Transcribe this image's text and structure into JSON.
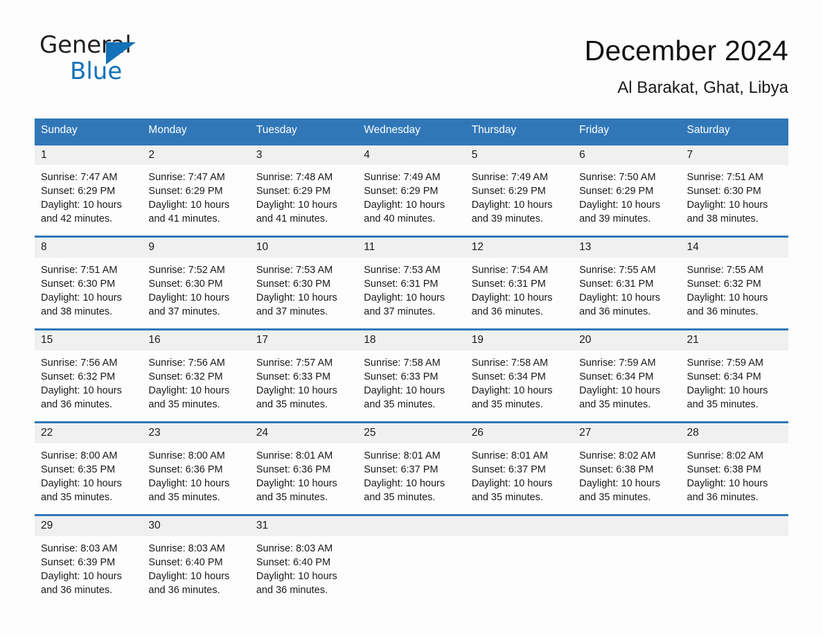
{
  "logo": {
    "word_one": "General",
    "word_two": "Blue",
    "triangle_icon": "blue-triangle-icon",
    "brand_blue": "#1271b8"
  },
  "header": {
    "title": "December 2024",
    "location": "Al Barakat, Ghat, Libya"
  },
  "theme": {
    "header_blue": "#3177b8",
    "daynum_band": "#f0f0f0",
    "page_background": "#fdfdfd",
    "text": "#1a1a1a"
  },
  "calendar": {
    "weekday_headers": [
      "Sunday",
      "Monday",
      "Tuesday",
      "Wednesday",
      "Thursday",
      "Friday",
      "Saturday"
    ],
    "weeks": [
      [
        {
          "day": "1",
          "sunrise": "Sunrise: 7:47 AM",
          "sunset": "Sunset: 6:29 PM",
          "daylight_line1": "Daylight: 10 hours",
          "daylight_line2": "and 42 minutes."
        },
        {
          "day": "2",
          "sunrise": "Sunrise: 7:47 AM",
          "sunset": "Sunset: 6:29 PM",
          "daylight_line1": "Daylight: 10 hours",
          "daylight_line2": "and 41 minutes."
        },
        {
          "day": "3",
          "sunrise": "Sunrise: 7:48 AM",
          "sunset": "Sunset: 6:29 PM",
          "daylight_line1": "Daylight: 10 hours",
          "daylight_line2": "and 41 minutes."
        },
        {
          "day": "4",
          "sunrise": "Sunrise: 7:49 AM",
          "sunset": "Sunset: 6:29 PM",
          "daylight_line1": "Daylight: 10 hours",
          "daylight_line2": "and 40 minutes."
        },
        {
          "day": "5",
          "sunrise": "Sunrise: 7:49 AM",
          "sunset": "Sunset: 6:29 PM",
          "daylight_line1": "Daylight: 10 hours",
          "daylight_line2": "and 39 minutes."
        },
        {
          "day": "6",
          "sunrise": "Sunrise: 7:50 AM",
          "sunset": "Sunset: 6:29 PM",
          "daylight_line1": "Daylight: 10 hours",
          "daylight_line2": "and 39 minutes."
        },
        {
          "day": "7",
          "sunrise": "Sunrise: 7:51 AM",
          "sunset": "Sunset: 6:30 PM",
          "daylight_line1": "Daylight: 10 hours",
          "daylight_line2": "and 38 minutes."
        }
      ],
      [
        {
          "day": "8",
          "sunrise": "Sunrise: 7:51 AM",
          "sunset": "Sunset: 6:30 PM",
          "daylight_line1": "Daylight: 10 hours",
          "daylight_line2": "and 38 minutes."
        },
        {
          "day": "9",
          "sunrise": "Sunrise: 7:52 AM",
          "sunset": "Sunset: 6:30 PM",
          "daylight_line1": "Daylight: 10 hours",
          "daylight_line2": "and 37 minutes."
        },
        {
          "day": "10",
          "sunrise": "Sunrise: 7:53 AM",
          "sunset": "Sunset: 6:30 PM",
          "daylight_line1": "Daylight: 10 hours",
          "daylight_line2": "and 37 minutes."
        },
        {
          "day": "11",
          "sunrise": "Sunrise: 7:53 AM",
          "sunset": "Sunset: 6:31 PM",
          "daylight_line1": "Daylight: 10 hours",
          "daylight_line2": "and 37 minutes."
        },
        {
          "day": "12",
          "sunrise": "Sunrise: 7:54 AM",
          "sunset": "Sunset: 6:31 PM",
          "daylight_line1": "Daylight: 10 hours",
          "daylight_line2": "and 36 minutes."
        },
        {
          "day": "13",
          "sunrise": "Sunrise: 7:55 AM",
          "sunset": "Sunset: 6:31 PM",
          "daylight_line1": "Daylight: 10 hours",
          "daylight_line2": "and 36 minutes."
        },
        {
          "day": "14",
          "sunrise": "Sunrise: 7:55 AM",
          "sunset": "Sunset: 6:32 PM",
          "daylight_line1": "Daylight: 10 hours",
          "daylight_line2": "and 36 minutes."
        }
      ],
      [
        {
          "day": "15",
          "sunrise": "Sunrise: 7:56 AM",
          "sunset": "Sunset: 6:32 PM",
          "daylight_line1": "Daylight: 10 hours",
          "daylight_line2": "and 36 minutes."
        },
        {
          "day": "16",
          "sunrise": "Sunrise: 7:56 AM",
          "sunset": "Sunset: 6:32 PM",
          "daylight_line1": "Daylight: 10 hours",
          "daylight_line2": "and 35 minutes."
        },
        {
          "day": "17",
          "sunrise": "Sunrise: 7:57 AM",
          "sunset": "Sunset: 6:33 PM",
          "daylight_line1": "Daylight: 10 hours",
          "daylight_line2": "and 35 minutes."
        },
        {
          "day": "18",
          "sunrise": "Sunrise: 7:58 AM",
          "sunset": "Sunset: 6:33 PM",
          "daylight_line1": "Daylight: 10 hours",
          "daylight_line2": "and 35 minutes."
        },
        {
          "day": "19",
          "sunrise": "Sunrise: 7:58 AM",
          "sunset": "Sunset: 6:34 PM",
          "daylight_line1": "Daylight: 10 hours",
          "daylight_line2": "and 35 minutes."
        },
        {
          "day": "20",
          "sunrise": "Sunrise: 7:59 AM",
          "sunset": "Sunset: 6:34 PM",
          "daylight_line1": "Daylight: 10 hours",
          "daylight_line2": "and 35 minutes."
        },
        {
          "day": "21",
          "sunrise": "Sunrise: 7:59 AM",
          "sunset": "Sunset: 6:34 PM",
          "daylight_line1": "Daylight: 10 hours",
          "daylight_line2": "and 35 minutes."
        }
      ],
      [
        {
          "day": "22",
          "sunrise": "Sunrise: 8:00 AM",
          "sunset": "Sunset: 6:35 PM",
          "daylight_line1": "Daylight: 10 hours",
          "daylight_line2": "and 35 minutes."
        },
        {
          "day": "23",
          "sunrise": "Sunrise: 8:00 AM",
          "sunset": "Sunset: 6:36 PM",
          "daylight_line1": "Daylight: 10 hours",
          "daylight_line2": "and 35 minutes."
        },
        {
          "day": "24",
          "sunrise": "Sunrise: 8:01 AM",
          "sunset": "Sunset: 6:36 PM",
          "daylight_line1": "Daylight: 10 hours",
          "daylight_line2": "and 35 minutes."
        },
        {
          "day": "25",
          "sunrise": "Sunrise: 8:01 AM",
          "sunset": "Sunset: 6:37 PM",
          "daylight_line1": "Daylight: 10 hours",
          "daylight_line2": "and 35 minutes."
        },
        {
          "day": "26",
          "sunrise": "Sunrise: 8:01 AM",
          "sunset": "Sunset: 6:37 PM",
          "daylight_line1": "Daylight: 10 hours",
          "daylight_line2": "and 35 minutes."
        },
        {
          "day": "27",
          "sunrise": "Sunrise: 8:02 AM",
          "sunset": "Sunset: 6:38 PM",
          "daylight_line1": "Daylight: 10 hours",
          "daylight_line2": "and 35 minutes."
        },
        {
          "day": "28",
          "sunrise": "Sunrise: 8:02 AM",
          "sunset": "Sunset: 6:38 PM",
          "daylight_line1": "Daylight: 10 hours",
          "daylight_line2": "and 36 minutes."
        }
      ],
      [
        {
          "day": "29",
          "sunrise": "Sunrise: 8:03 AM",
          "sunset": "Sunset: 6:39 PM",
          "daylight_line1": "Daylight: 10 hours",
          "daylight_line2": "and 36 minutes."
        },
        {
          "day": "30",
          "sunrise": "Sunrise: 8:03 AM",
          "sunset": "Sunset: 6:40 PM",
          "daylight_line1": "Daylight: 10 hours",
          "daylight_line2": "and 36 minutes."
        },
        {
          "day": "31",
          "sunrise": "Sunrise: 8:03 AM",
          "sunset": "Sunset: 6:40 PM",
          "daylight_line1": "Daylight: 10 hours",
          "daylight_line2": "and 36 minutes."
        },
        {
          "day": "",
          "sunrise": "",
          "sunset": "",
          "daylight_line1": "",
          "daylight_line2": ""
        },
        {
          "day": "",
          "sunrise": "",
          "sunset": "",
          "daylight_line1": "",
          "daylight_line2": ""
        },
        {
          "day": "",
          "sunrise": "",
          "sunset": "",
          "daylight_line1": "",
          "daylight_line2": ""
        },
        {
          "day": "",
          "sunrise": "",
          "sunset": "",
          "daylight_line1": "",
          "daylight_line2": ""
        }
      ]
    ]
  }
}
